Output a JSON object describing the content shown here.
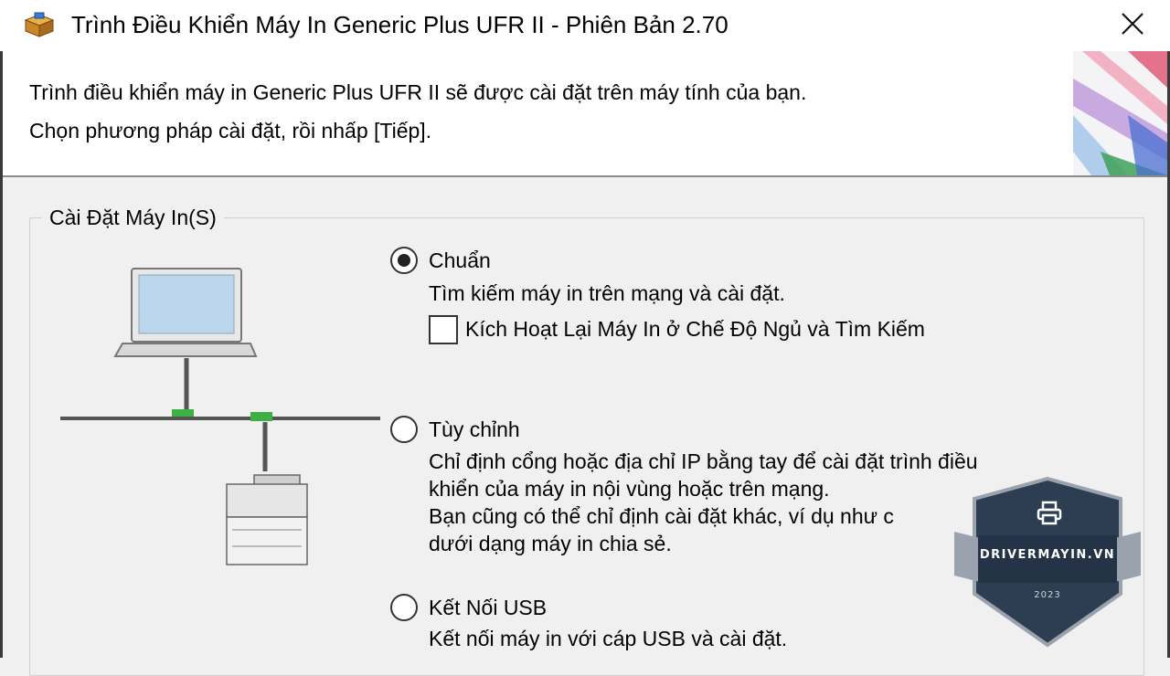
{
  "window": {
    "title": "Trình Điều Khiển Máy In Generic Plus UFR II - Phiên Bản 2.70",
    "icon": "installer-box-icon",
    "close_icon": "close-icon"
  },
  "header": {
    "line1": "Trình điều khiển máy in Generic Plus UFR II sẽ được cài đặt trên máy tính của bạn.",
    "line2": "Chọn phương pháp cài đặt, rồi nhấp [Tiếp]."
  },
  "group": {
    "title": "Cài Đặt Máy In(S)",
    "options": [
      {
        "label": "Chuẩn",
        "selected": true,
        "desc": [
          "Tìm kiếm máy in trên mạng và cài đặt."
        ],
        "checkbox": {
          "label": "Kích Hoạt Lại Máy In ở Chế Độ Ngủ và Tìm Kiếm",
          "checked": false
        }
      },
      {
        "label": "Tùy chỉnh",
        "selected": false,
        "desc": [
          "Chỉ định cổng hoặc địa chỉ IP bằng tay để cài đặt trình điều",
          "khiển của máy in nội vùng hoặc trên mạng.",
          "Bạn cũng có thể chỉ định cài đặt khác, ví dụ như c",
          "dưới dạng máy in chia sẻ."
        ]
      },
      {
        "label": "Kết Nối USB",
        "selected": false,
        "desc": [
          "Kết nối máy in với cáp USB và cài đặt."
        ]
      }
    ]
  },
  "watermark": {
    "text": "DRIVERMAYIN.VN",
    "year": "2023",
    "icon": "printer-icon"
  }
}
